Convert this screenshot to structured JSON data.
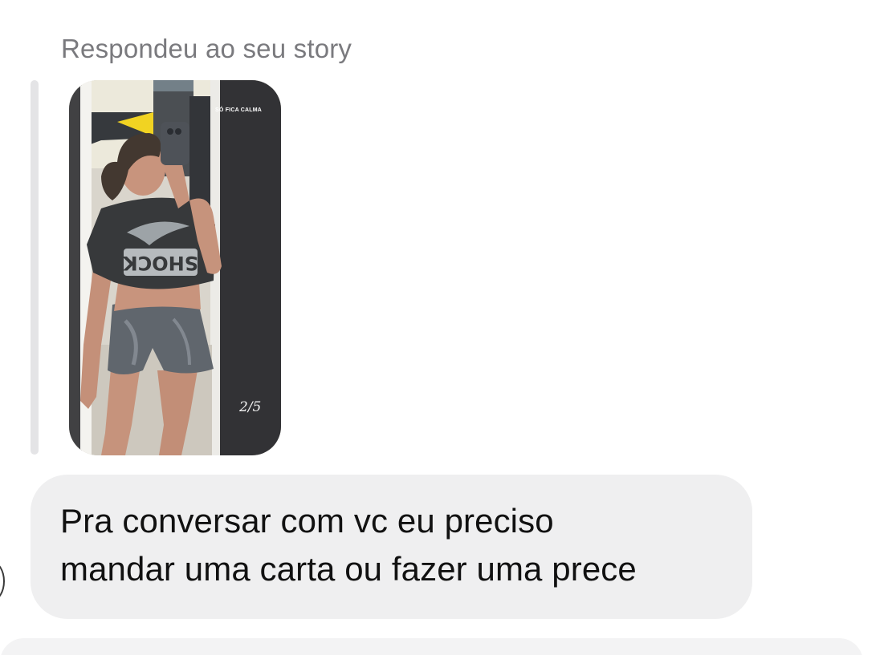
{
  "reply": {
    "header": "Respondeu ao seu story"
  },
  "story": {
    "caption": "SÓ FICA CALMA",
    "counter": "2/5",
    "shirt_text": "SHOCK"
  },
  "message": {
    "lines": [
      "Pra conversar com vc eu preciso",
      "mandar uma carta ou fazer uma prece"
    ]
  },
  "colors": {
    "bubble": "#efeff0",
    "header_text": "#7a7a7e",
    "reply_bar": "#e4e4e6"
  }
}
